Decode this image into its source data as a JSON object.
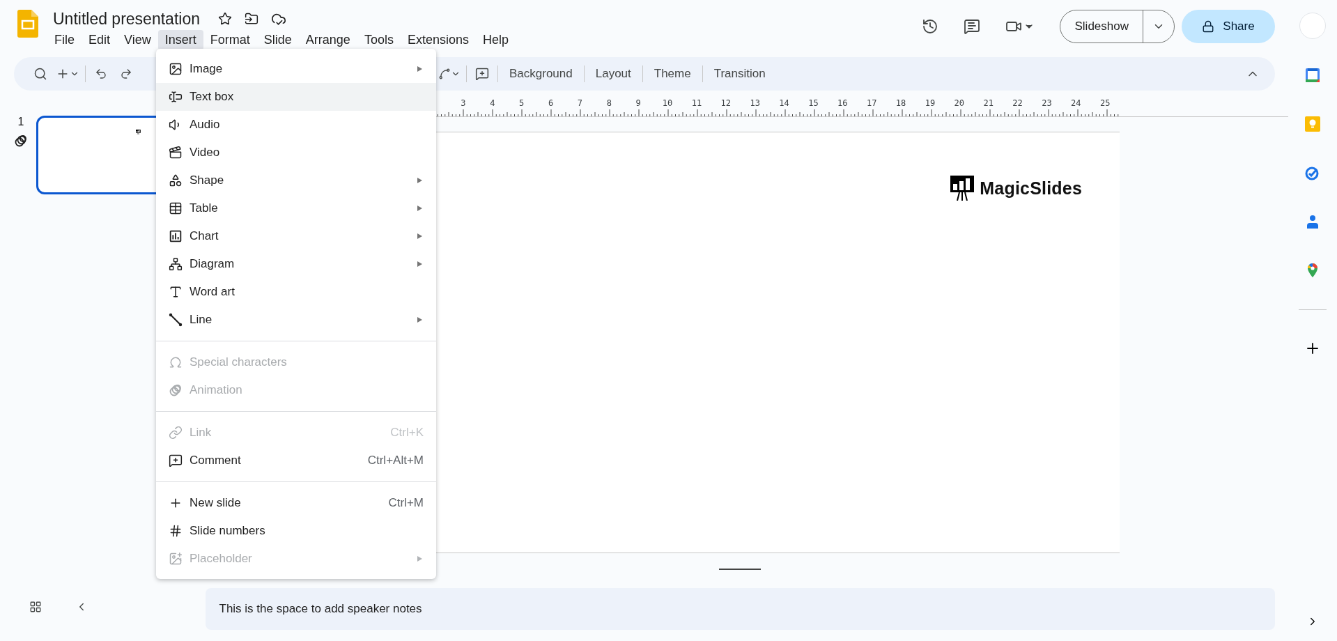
{
  "app": {
    "title": "Untitled presentation"
  },
  "menu_bar": [
    {
      "label": "File",
      "selected": false
    },
    {
      "label": "Edit",
      "selected": false
    },
    {
      "label": "View",
      "selected": false
    },
    {
      "label": "Insert",
      "selected": true
    },
    {
      "label": "Format",
      "selected": false
    },
    {
      "label": "Slide",
      "selected": false
    },
    {
      "label": "Arrange",
      "selected": false
    },
    {
      "label": "Tools",
      "selected": false
    },
    {
      "label": "Extensions",
      "selected": false
    },
    {
      "label": "Help",
      "selected": false
    }
  ],
  "header_buttons": {
    "slideshow": "Slideshow",
    "share": "Share"
  },
  "toolbar": {
    "text_buttons": [
      "Background",
      "Layout",
      "Theme",
      "Transition"
    ]
  },
  "ruler": [
    "3",
    "4",
    "5",
    "6",
    "7",
    "8",
    "9",
    "10",
    "11",
    "12",
    "13",
    "14",
    "15",
    "16",
    "17",
    "18",
    "19",
    "20",
    "21",
    "22",
    "23",
    "24",
    "25"
  ],
  "filmstrip": [
    {
      "number": "1",
      "selected": true
    }
  ],
  "slide": {
    "logo_text": "MagicSlides"
  },
  "insert_menu": {
    "sections": [
      [
        {
          "label": "Image",
          "has_submenu": true,
          "disabled": false,
          "selected": false
        },
        {
          "label": "Text box",
          "has_submenu": false,
          "disabled": false,
          "selected": true
        },
        {
          "label": "Audio",
          "has_submenu": false,
          "disabled": false,
          "selected": false
        },
        {
          "label": "Video",
          "has_submenu": false,
          "disabled": false,
          "selected": false
        },
        {
          "label": "Shape",
          "has_submenu": true,
          "disabled": false,
          "selected": false
        },
        {
          "label": "Table",
          "has_submenu": true,
          "disabled": false,
          "selected": false
        },
        {
          "label": "Chart",
          "has_submenu": true,
          "disabled": false,
          "selected": false
        },
        {
          "label": "Diagram",
          "has_submenu": true,
          "disabled": false,
          "selected": false
        },
        {
          "label": "Word art",
          "has_submenu": false,
          "disabled": false,
          "selected": false
        },
        {
          "label": "Line",
          "has_submenu": true,
          "disabled": false,
          "selected": false
        }
      ],
      [
        {
          "label": "Special characters",
          "has_submenu": false,
          "disabled": true,
          "selected": false
        },
        {
          "label": "Animation",
          "has_submenu": false,
          "disabled": true,
          "selected": false
        }
      ],
      [
        {
          "label": "Link",
          "shortcut": "Ctrl+K",
          "has_submenu": false,
          "disabled": true,
          "selected": false
        },
        {
          "label": "Comment",
          "shortcut": "Ctrl+Alt+M",
          "has_submenu": false,
          "disabled": false,
          "selected": false
        }
      ],
      [
        {
          "label": "New slide",
          "shortcut": "Ctrl+M",
          "has_submenu": false,
          "disabled": false,
          "selected": false
        },
        {
          "label": "Slide numbers",
          "has_submenu": false,
          "disabled": false,
          "selected": false
        },
        {
          "label": "Placeholder",
          "has_submenu": true,
          "disabled": true,
          "selected": false
        }
      ]
    ]
  },
  "speaker_notes": "This is the space to add speaker notes"
}
